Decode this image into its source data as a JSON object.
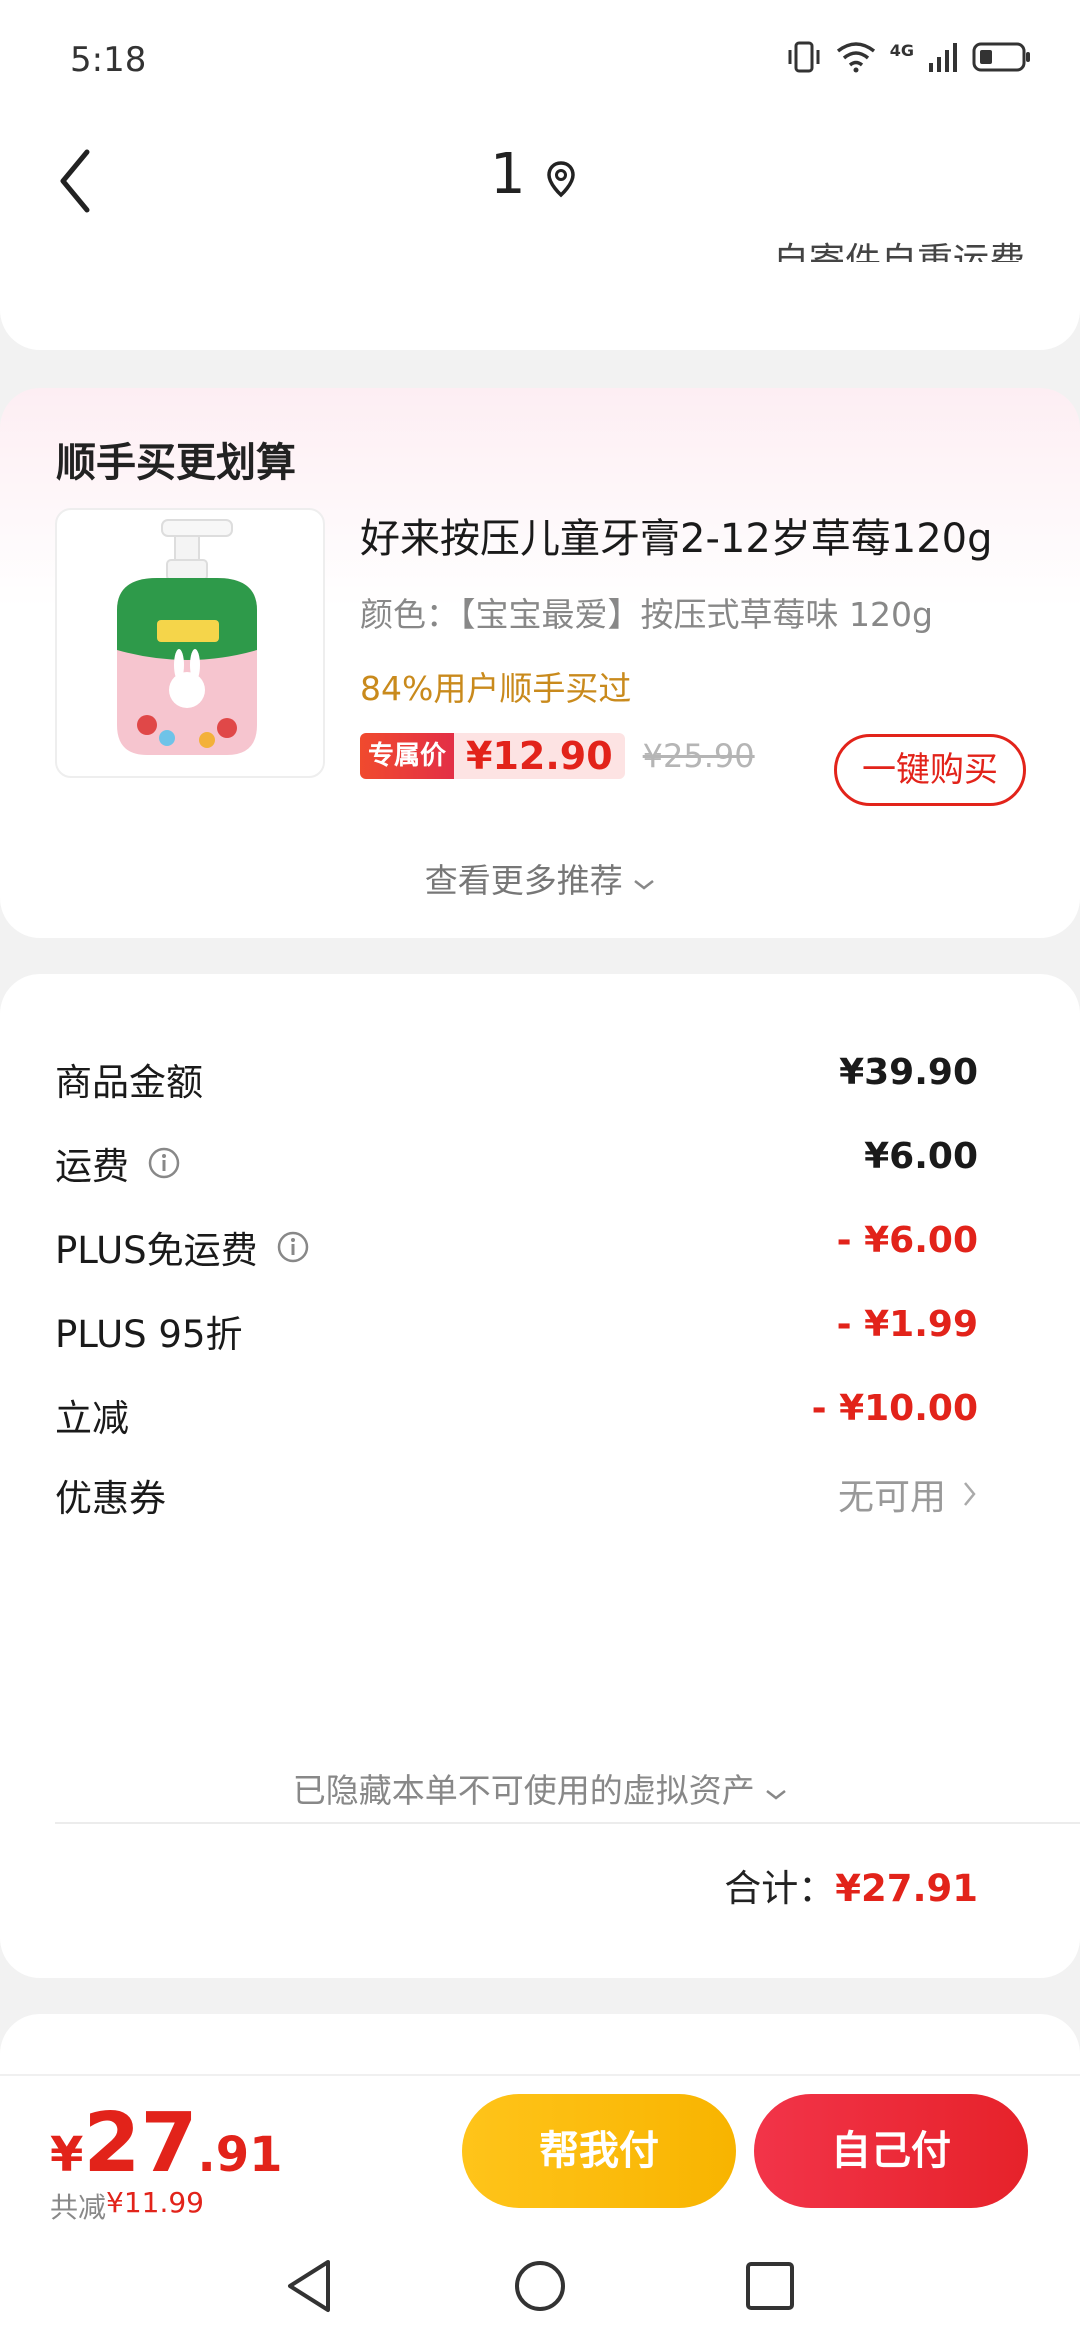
{
  "status_bar": {
    "time": "5:18",
    "network": "4G"
  },
  "header": {
    "title": "1",
    "subtitle": "自寄件自重运费"
  },
  "upsell": {
    "title": "顺手买更划算",
    "product_name": "好来按压儿童牙膏2-12岁草莓120g",
    "spec": "颜色：【宝宝最爱】按压式草莓味 120g",
    "bought": "84%用户顺手买过",
    "badge": "专属价",
    "price": "¥12.90",
    "original_price": "¥25.90",
    "buy_label": "一键购买",
    "more_label": "查看更多推荐"
  },
  "summary": {
    "rows": [
      {
        "label": "商品金额",
        "value": "¥39.90"
      },
      {
        "label": "运费",
        "value": "¥6.00"
      },
      {
        "label": "PLUS免运费",
        "value": "- ¥6.00"
      },
      {
        "label": "PLUS 95折",
        "value": "- ¥1.99"
      },
      {
        "label": "立减",
        "value": "- ¥10.00"
      },
      {
        "label": "优惠券",
        "value": "无可用"
      }
    ],
    "hidden_assets": "已隐藏本单不可使用的虚拟资产",
    "total_label": "合计：",
    "total_value": "¥27.91"
  },
  "bottom": {
    "currency": "¥",
    "amount_int": "27",
    "amount_dec": ".91",
    "saved_label": "共减",
    "saved_value": "¥11.99",
    "help_pay": "帮我付",
    "self_pay": "自己付"
  },
  "colors": {
    "accent_red": "#e2231a",
    "yellow": "#ffc41a",
    "gold_text": "#c98a1c"
  },
  "icons": [
    "back-arrow-icon",
    "location-pin-icon",
    "info-icon",
    "chevron-right-icon",
    "chevron-down-icon"
  ]
}
